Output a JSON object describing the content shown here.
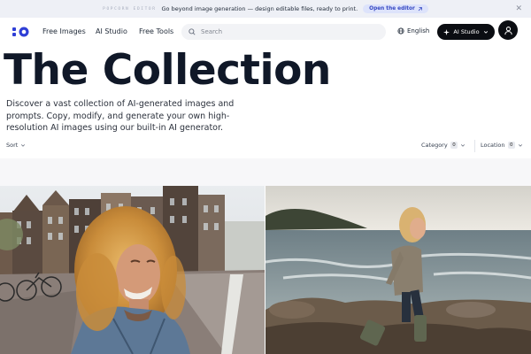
{
  "announcement": {
    "brand": "POPCORN EDITOR",
    "message": "Go beyond image generation — design editable files, ready to print.",
    "cta_label": "Open the editor",
    "cta_icon": "external-link-icon",
    "close_icon": "close-icon"
  },
  "nav": {
    "logo_icon": "brand-logo-icon",
    "links": [
      "Free Images",
      "AI Studio",
      "Free Tools"
    ],
    "search_placeholder": "Search",
    "language": "English",
    "studio_button": "AI Studio",
    "avatar_icon": "user-icon"
  },
  "hero": {
    "title": "The Collection",
    "description": "Discover a vast collection of AI-generated images and prompts. Copy, modify, and generate your own high-resolution AI images using our built-in AI generator."
  },
  "filters": {
    "sort_label": "Sort",
    "category_label": "Category",
    "category_count": "0",
    "location_label": "Location",
    "location_count": "0"
  },
  "gallery": {
    "items": [
      {
        "subject": "woman-portrait-amsterdam"
      },
      {
        "subject": "child-walking-seaside-rocks"
      }
    ]
  },
  "colors": {
    "accent": "#3548c2",
    "dark_button": "#0b0d12",
    "title": "#101828"
  }
}
